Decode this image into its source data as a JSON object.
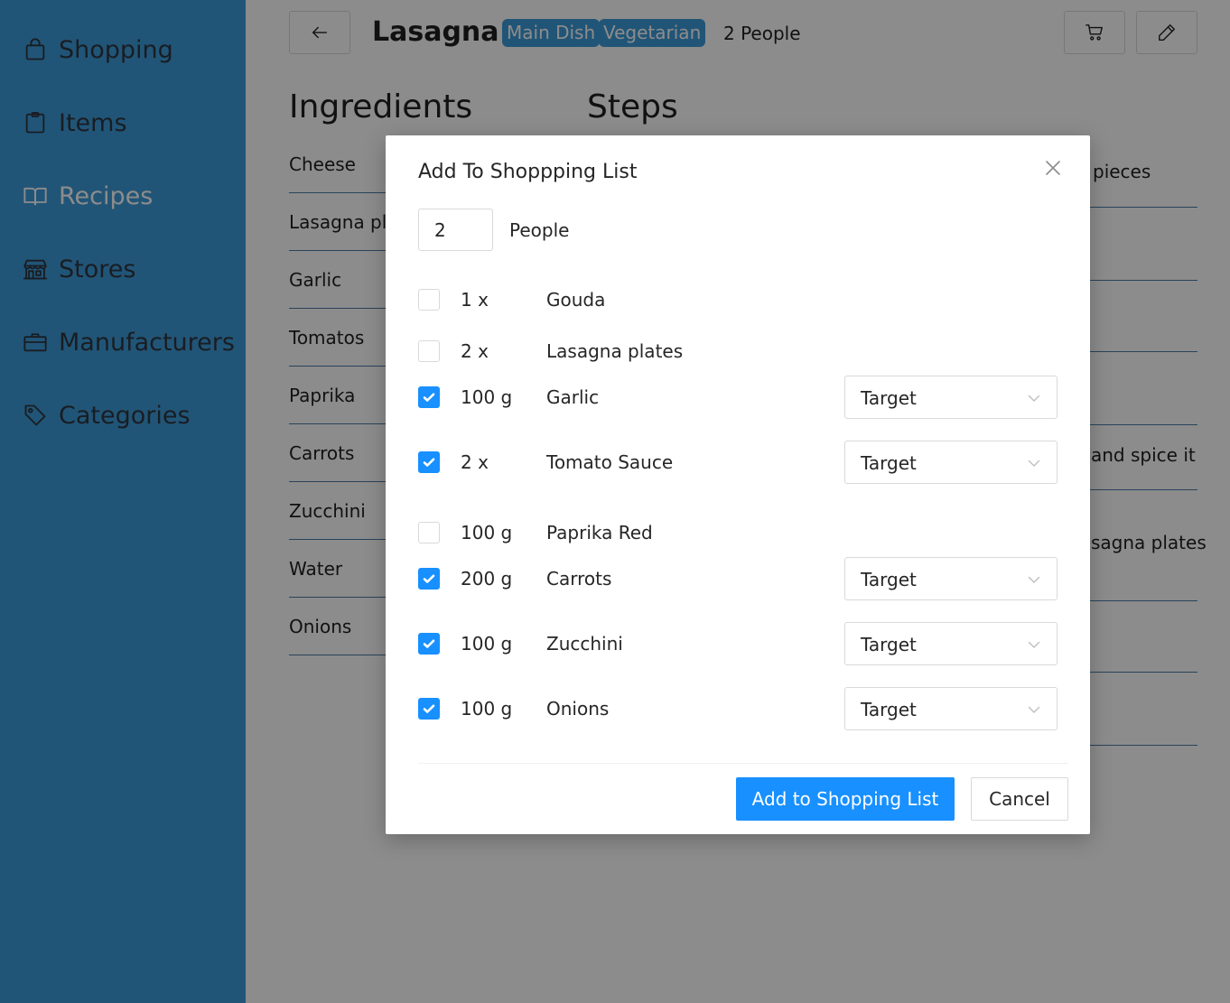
{
  "sidebar": {
    "items": [
      {
        "label": "Shopping",
        "icon": "shopping-bag-icon",
        "active": false
      },
      {
        "label": "Items",
        "icon": "clipboard-icon",
        "active": false
      },
      {
        "label": "Recipes",
        "icon": "book-icon",
        "active": true
      },
      {
        "label": "Stores",
        "icon": "shop-icon",
        "active": false
      },
      {
        "label": "Manufacturers",
        "icon": "briefcase-icon",
        "active": false
      },
      {
        "label": "Categories",
        "icon": "tag-icon",
        "active": false
      }
    ]
  },
  "recipe": {
    "back_icon": "arrow-left-icon",
    "title": "Lasagna",
    "tags": [
      "Main Dish",
      "Vegetarian"
    ],
    "people": "2 People",
    "cart_icon": "shopping-cart-icon",
    "edit_icon": "pencil-icon",
    "ingredients_heading": "Ingredients",
    "steps_heading": "Steps",
    "ingredients": [
      "Cheese",
      "Lasagna pla",
      "Garlic",
      "Tomatos",
      "Paprika",
      "Carrots",
      "Zucchini",
      "Water",
      "Onions"
    ],
    "steps_visible_fragments": [
      "pieces",
      "and spice it",
      "sagna plates"
    ]
  },
  "modal": {
    "title": "Add To Shoppping List",
    "close_icon": "close-icon",
    "people_value": "2",
    "people_label": "People",
    "items": [
      {
        "checked": false,
        "quantity": "1 x",
        "name": "Gouda",
        "store": null
      },
      {
        "checked": false,
        "quantity": "2 x",
        "name": "Lasagna plates",
        "store": null
      },
      {
        "checked": true,
        "quantity": "100 g",
        "name": "Garlic",
        "store": "Target"
      },
      {
        "checked": true,
        "quantity": "2 x",
        "name": "Tomato Sauce",
        "store": "Target"
      },
      {
        "checked": false,
        "quantity": "100 g",
        "name": "Paprika Red",
        "store": null
      },
      {
        "checked": true,
        "quantity": "200 g",
        "name": "Carrots",
        "store": "Target"
      },
      {
        "checked": true,
        "quantity": "100 g",
        "name": "Zucchini",
        "store": "Target"
      },
      {
        "checked": true,
        "quantity": "100 g",
        "name": "Onions",
        "store": "Target"
      }
    ],
    "submit_label": "Add to Shopping List",
    "cancel_label": "Cancel"
  },
  "colors": {
    "sidebar_bg": "#3d9bd9",
    "primary": "#1890ff",
    "tag_bg": "#3d9bd9",
    "overlay": "rgba(0,0,0,0.45)"
  }
}
